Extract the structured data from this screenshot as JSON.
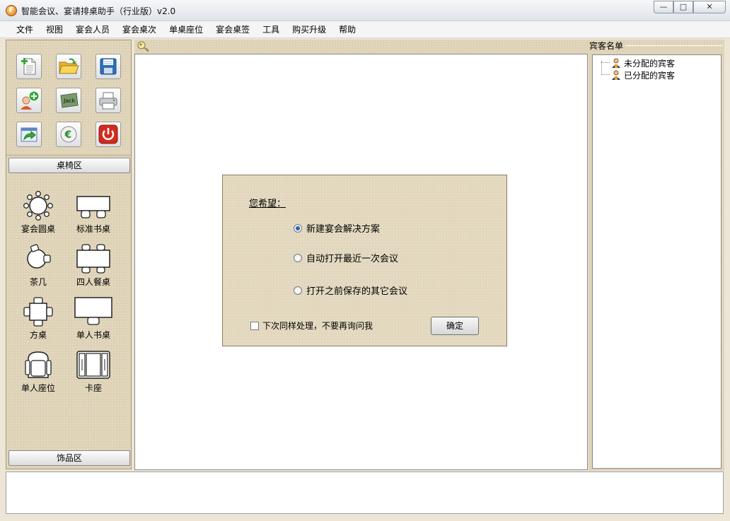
{
  "window": {
    "app_icon_letter": "F",
    "title": "智能会议、宴请排桌助手（行业版）v2.0",
    "min_glyph": "—",
    "max_glyph": "□",
    "close_glyph": "✕"
  },
  "menu": [
    "文件",
    "视图",
    "宴会人员",
    "宴会桌次",
    "单桌座位",
    "宴会桌签",
    "工具",
    "购买升级",
    "帮助"
  ],
  "toolbar": {
    "icons": [
      "new-document-icon",
      "open-folder-icon",
      "save-disk-icon",
      "add-person-icon",
      "name-card-icon",
      "printer-icon",
      "export-arrow-icon",
      "euro-coin-icon",
      "power-icon"
    ],
    "name_card_text": "Jack"
  },
  "left_panel": {
    "section_tables": "桌椅区",
    "section_decor": "饰品区",
    "furniture": [
      "宴会圆桌",
      "标准书桌",
      "茶几",
      "四人餐桌",
      "方桌",
      "单人书桌",
      "单人座位",
      "卡座"
    ]
  },
  "dialog": {
    "heading": "您希望：",
    "options": [
      "新建宴会解决方案",
      "自动打开最近一次会议",
      "打开之前保存的其它会议"
    ],
    "selected_index": 0,
    "checkbox_label": "下次同样处理，不要再询问我",
    "checkbox_checked": false,
    "ok_label": "确定"
  },
  "guest_panel": {
    "title": "宾客名单",
    "items": [
      "未分配的宾客",
      "已分配的宾客"
    ]
  },
  "colors": {
    "panel_bg": "#ded2b6",
    "radio_dot": "#2f5fb8",
    "power_red": "#d42a1e"
  }
}
